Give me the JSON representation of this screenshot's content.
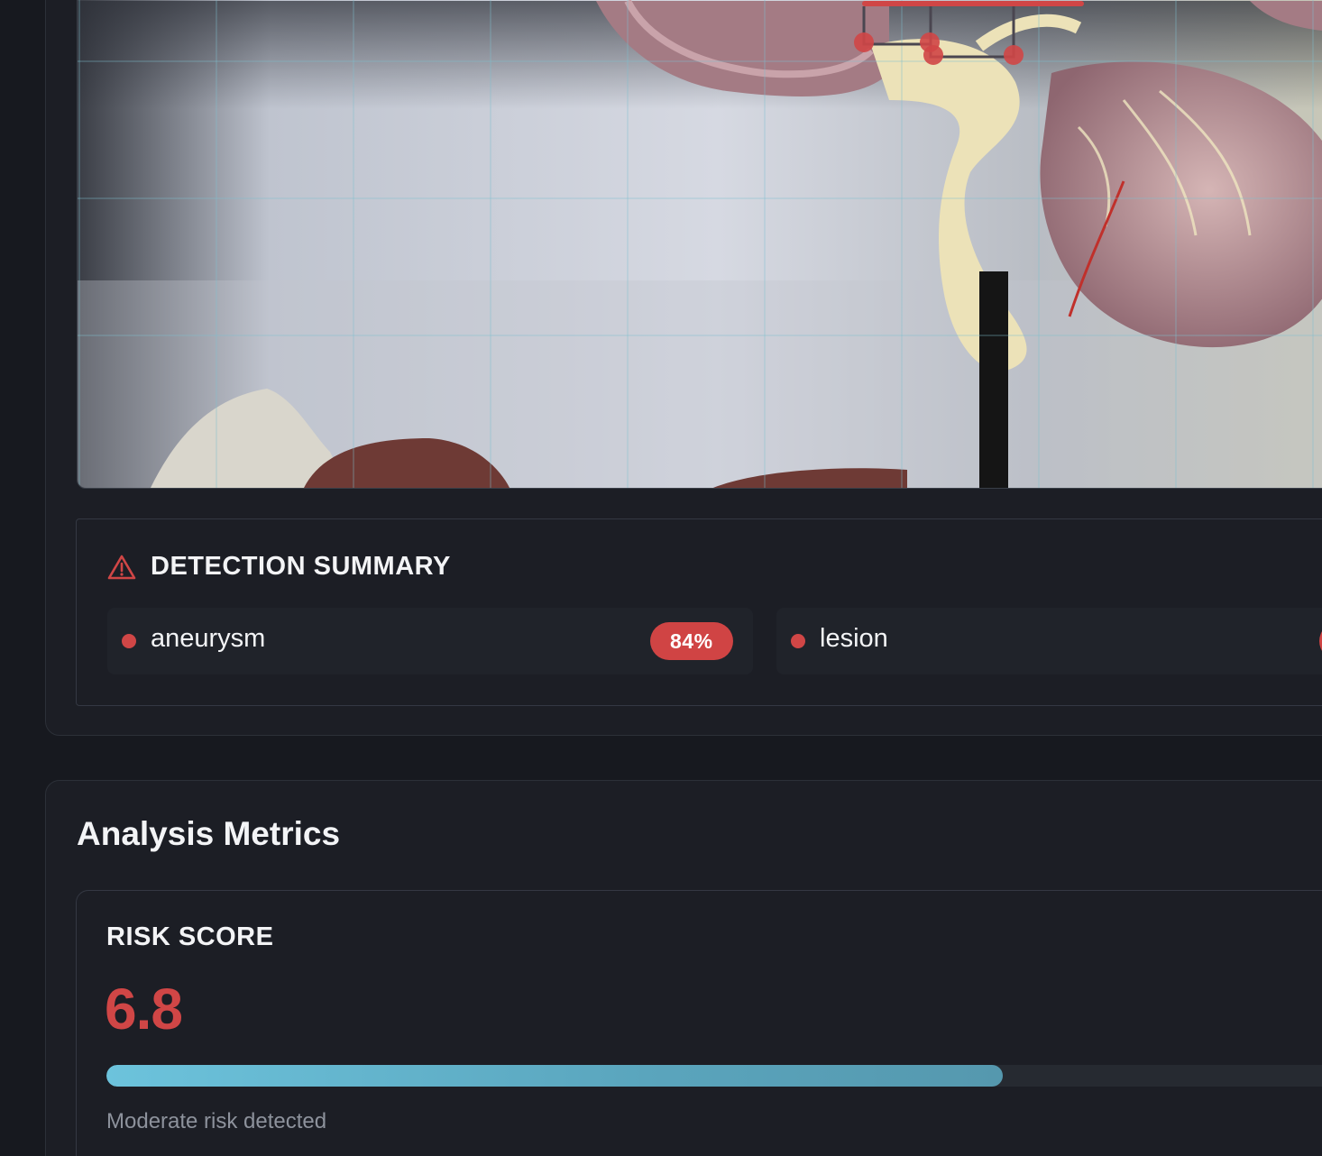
{
  "viewer": {
    "image_alt": "Anatomical brain model"
  },
  "detection_summary": {
    "title": "DETECTION SUMMARY",
    "items": [
      {
        "label": "aneurysm",
        "confidence": "84%"
      },
      {
        "label": "lesion",
        "confidence": ""
      }
    ]
  },
  "metrics": {
    "title": "Analysis Metrics",
    "risk": {
      "label": "RISK SCORE",
      "value": "6.8",
      "progress_fraction": 0.71,
      "note": "Moderate risk detected"
    }
  },
  "colors": {
    "alert": "#d04646",
    "accent": "#6cc3dc",
    "background": "#1c1e25"
  }
}
